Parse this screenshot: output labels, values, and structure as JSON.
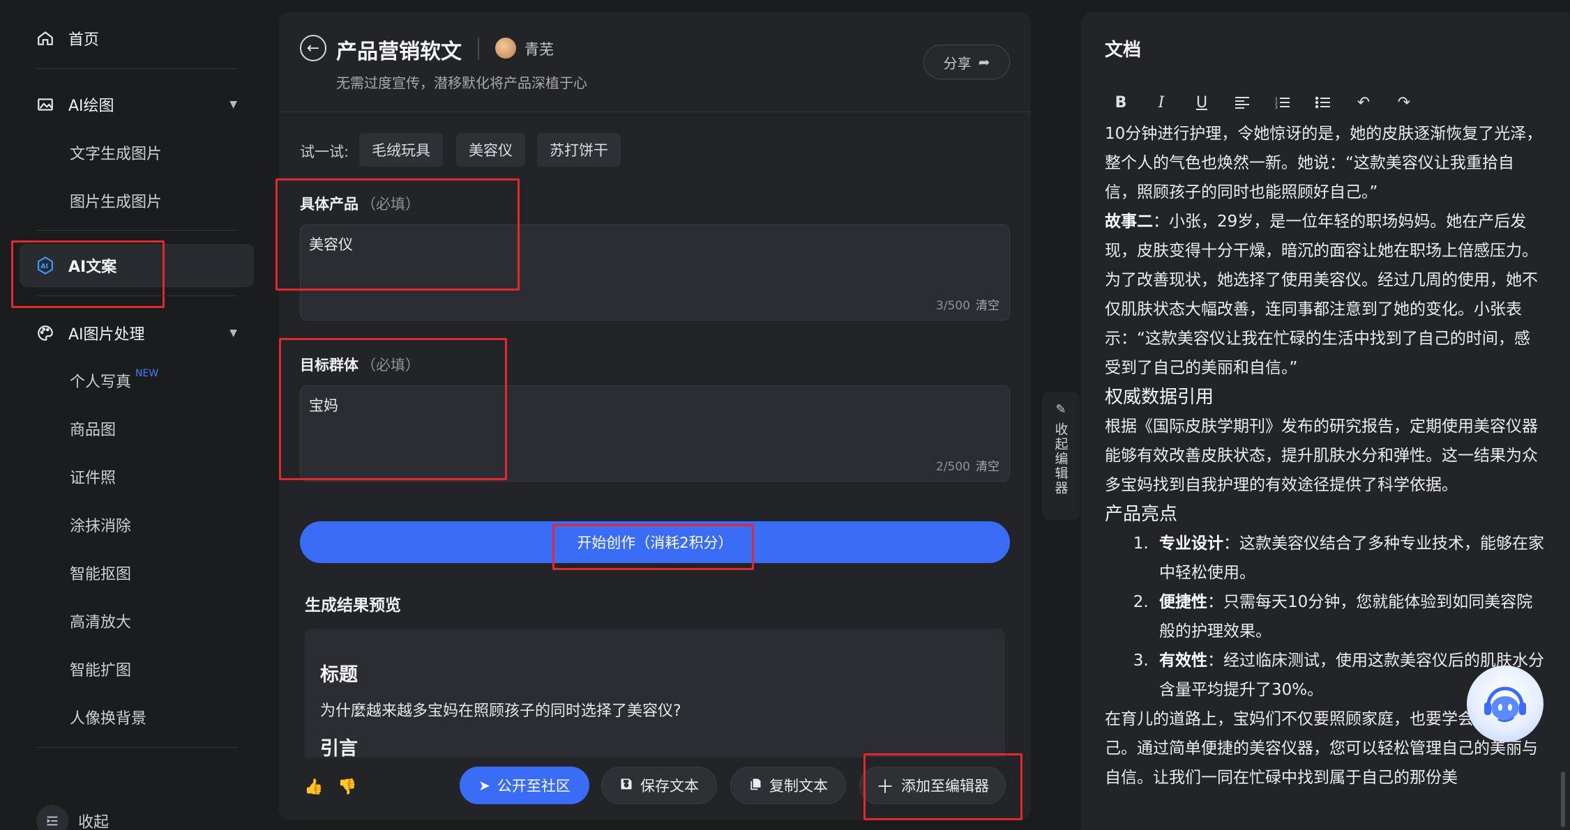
{
  "sidebar": {
    "home": "首页",
    "ai_drawing": "AI绘图",
    "text_to_image": "文字生成图片",
    "image_to_image": "图片生成图片",
    "ai_copywriting": "AI文案",
    "ai_image_processing": "AI图片处理",
    "sub_items": [
      {
        "label": "个人写真",
        "tag": "NEW"
      },
      {
        "label": "商品图"
      },
      {
        "label": "证件照"
      },
      {
        "label": "涂抹消除"
      },
      {
        "label": "智能抠图"
      },
      {
        "label": "高清放大"
      },
      {
        "label": "智能扩图"
      },
      {
        "label": "人像换背景"
      }
    ],
    "collapse": "收起"
  },
  "main": {
    "title": "产品营销软文",
    "author": "青芜",
    "subtitle": "无需过度宣传，潜移默化将产品深植于心",
    "share": "分享",
    "try_label": "试一试:",
    "chips": [
      "毛绒玩具",
      "美容仪",
      "苏打饼干"
    ],
    "product_label": "具体产品",
    "product_required": "（必填）",
    "product_value": "美容仪",
    "product_count": "3/500",
    "target_label": "目标群体",
    "target_required": "（必填）",
    "target_value": "宝妈",
    "target_count": "2/500",
    "clear": "清空",
    "start_button": "开始创作（消耗2积分）",
    "preview_label": "生成结果预览",
    "preview": {
      "h1": "标题",
      "p1": "为什麼越来越多宝妈在照顾孩子的同时选择了美容仪?",
      "h2": "引言"
    },
    "actions": {
      "publish": "公开至社区",
      "save": "保存文本",
      "copy": "复制文本",
      "add_to_editor": "添加至编辑器"
    }
  },
  "collapse_editor": "收起编辑器",
  "doc": {
    "title": "文档",
    "p1": "10分钟进行护理，令她惊讶的是，她的皮肤逐渐恢复了光泽，整个人的气色也焕然一新。她说：“这款美容仪让我重拾自信，照顾孩子的同时也能照顾好自己。”",
    "story2_label": "故事二",
    "story2": "：小张，29岁，是一位年轻的职场妈妈。她在产后发现，皮肤变得十分干燥，暗沉的面容让她在职场上倍感压力。为了改善现状，她选择了使用美容仪。经过几周的使用，她不仅肌肤状态大幅改善，连同事都注意到了她的变化。小张表示：“这款美容仪让我在忙碌的生活中找到了自己的时间，感受到了自己的美丽和自信。”",
    "h_authority": "权威数据引用",
    "p_authority": "根据《国际皮肤学期刊》发布的研究报告，定期使用美容仪器能够有效改善皮肤状态，提升肌肤水分和弹性。这一结果为众多宝妈找到自我护理的有效途径提供了科学依据。",
    "h_highlights": "产品亮点",
    "highlights": [
      {
        "label": "专业设计",
        "text": "：这款美容仪结合了多种专业技术，能够在家中轻松使用。"
      },
      {
        "label": "便捷性",
        "text": "：只需每天10分钟，您就能体验到如同美容院般的护理效果。"
      },
      {
        "label": "有效性",
        "text": "：经过临床测试，使用这款美容仪后的肌肤水分含量平均提升了30%。"
      }
    ],
    "p_final": "在育儿的道路上，宝妈们不仅要照顾家庭，也要学会关爱自己。通过简单便捷的美容仪器，您可以轻松管理自己的美丽与自信。让我们一同在忙碌中找到属于自己的那份美"
  },
  "colors": {
    "accent": "#3a6cf6",
    "highlight_box": "#e5282c",
    "new_tag": "#3b82f6"
  }
}
